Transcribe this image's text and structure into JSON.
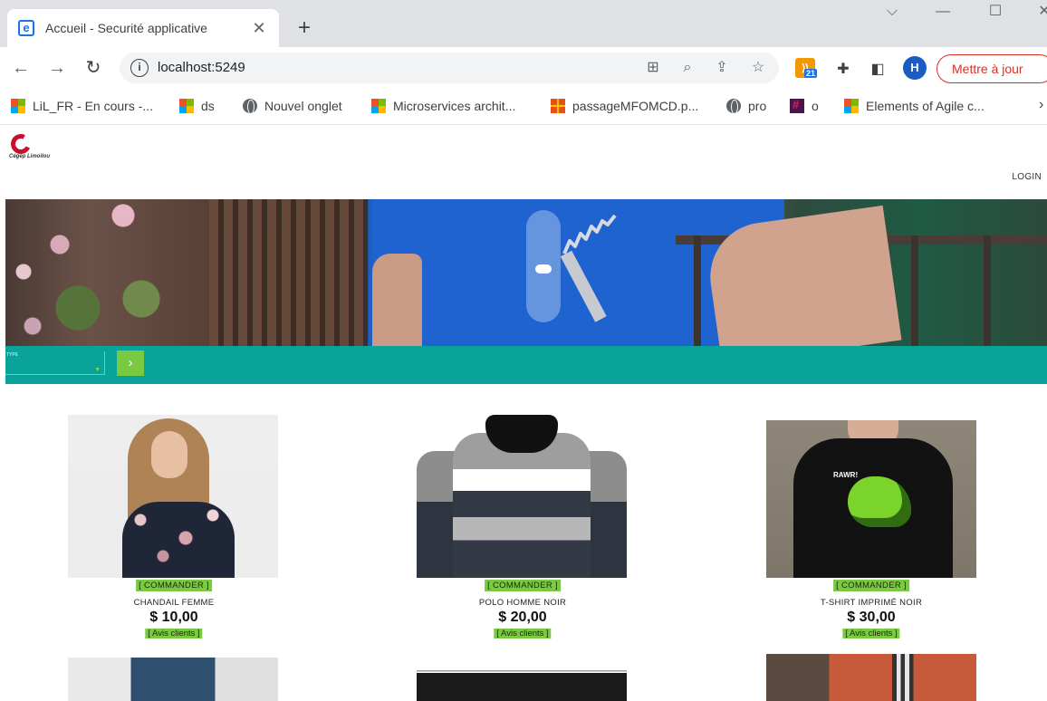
{
  "browser": {
    "tab_title": "Accueil - Securité applicative",
    "tab_favicon": "e",
    "new_tab": "+",
    "close_tab": "✕",
    "url": "localhost:5249",
    "profile_initial": "H",
    "extension_badge": "21",
    "update_label": "Mettre à jour",
    "bookmarks": [
      {
        "label": "LiL_FR - En cours -...",
        "icon": "microsoft-icon"
      },
      {
        "label": "ds",
        "icon": "microsoft-icon"
      },
      {
        "label": "Nouvel onglet",
        "icon": "globe-icon"
      },
      {
        "label": "Microservices archit...",
        "icon": "microsoft-icon"
      },
      {
        "label": "passageMFOMCD.p...",
        "icon": "pdf-icon"
      },
      {
        "label": "pro",
        "icon": "globe-icon"
      },
      {
        "label": "o",
        "icon": "slack-icon"
      },
      {
        "label": "Elements of Agile c...",
        "icon": "microsoft-icon"
      }
    ],
    "bookmarks_more": "›"
  },
  "site": {
    "logo_text": "Cégep Limoilou",
    "login_label": "LOGIN",
    "search": {
      "type_label": "TYPE",
      "go_label": "›"
    },
    "products": [
      {
        "order_label": "[ COMMANDER ]",
        "name": "CHANDAIL FEMME",
        "price": "$ 10,00",
        "reviews_label": "[ Avis clients ]"
      },
      {
        "order_label": "[ COMMANDER ]",
        "name": "POLO HOMME NOIR",
        "price": "$ 20,00",
        "reviews_label": "[ Avis clients ]"
      },
      {
        "order_label": "[ COMMANDER ]",
        "name": "T-SHIRT IMPRIMÉ NOIR",
        "price": "$ 30,00",
        "reviews_label": "[ Avis clients ]"
      }
    ],
    "hero_print": "RAWR!"
  },
  "colors": {
    "accent_teal": "#0aa39a",
    "button_green": "#7ac943",
    "update_red": "#d93025"
  }
}
